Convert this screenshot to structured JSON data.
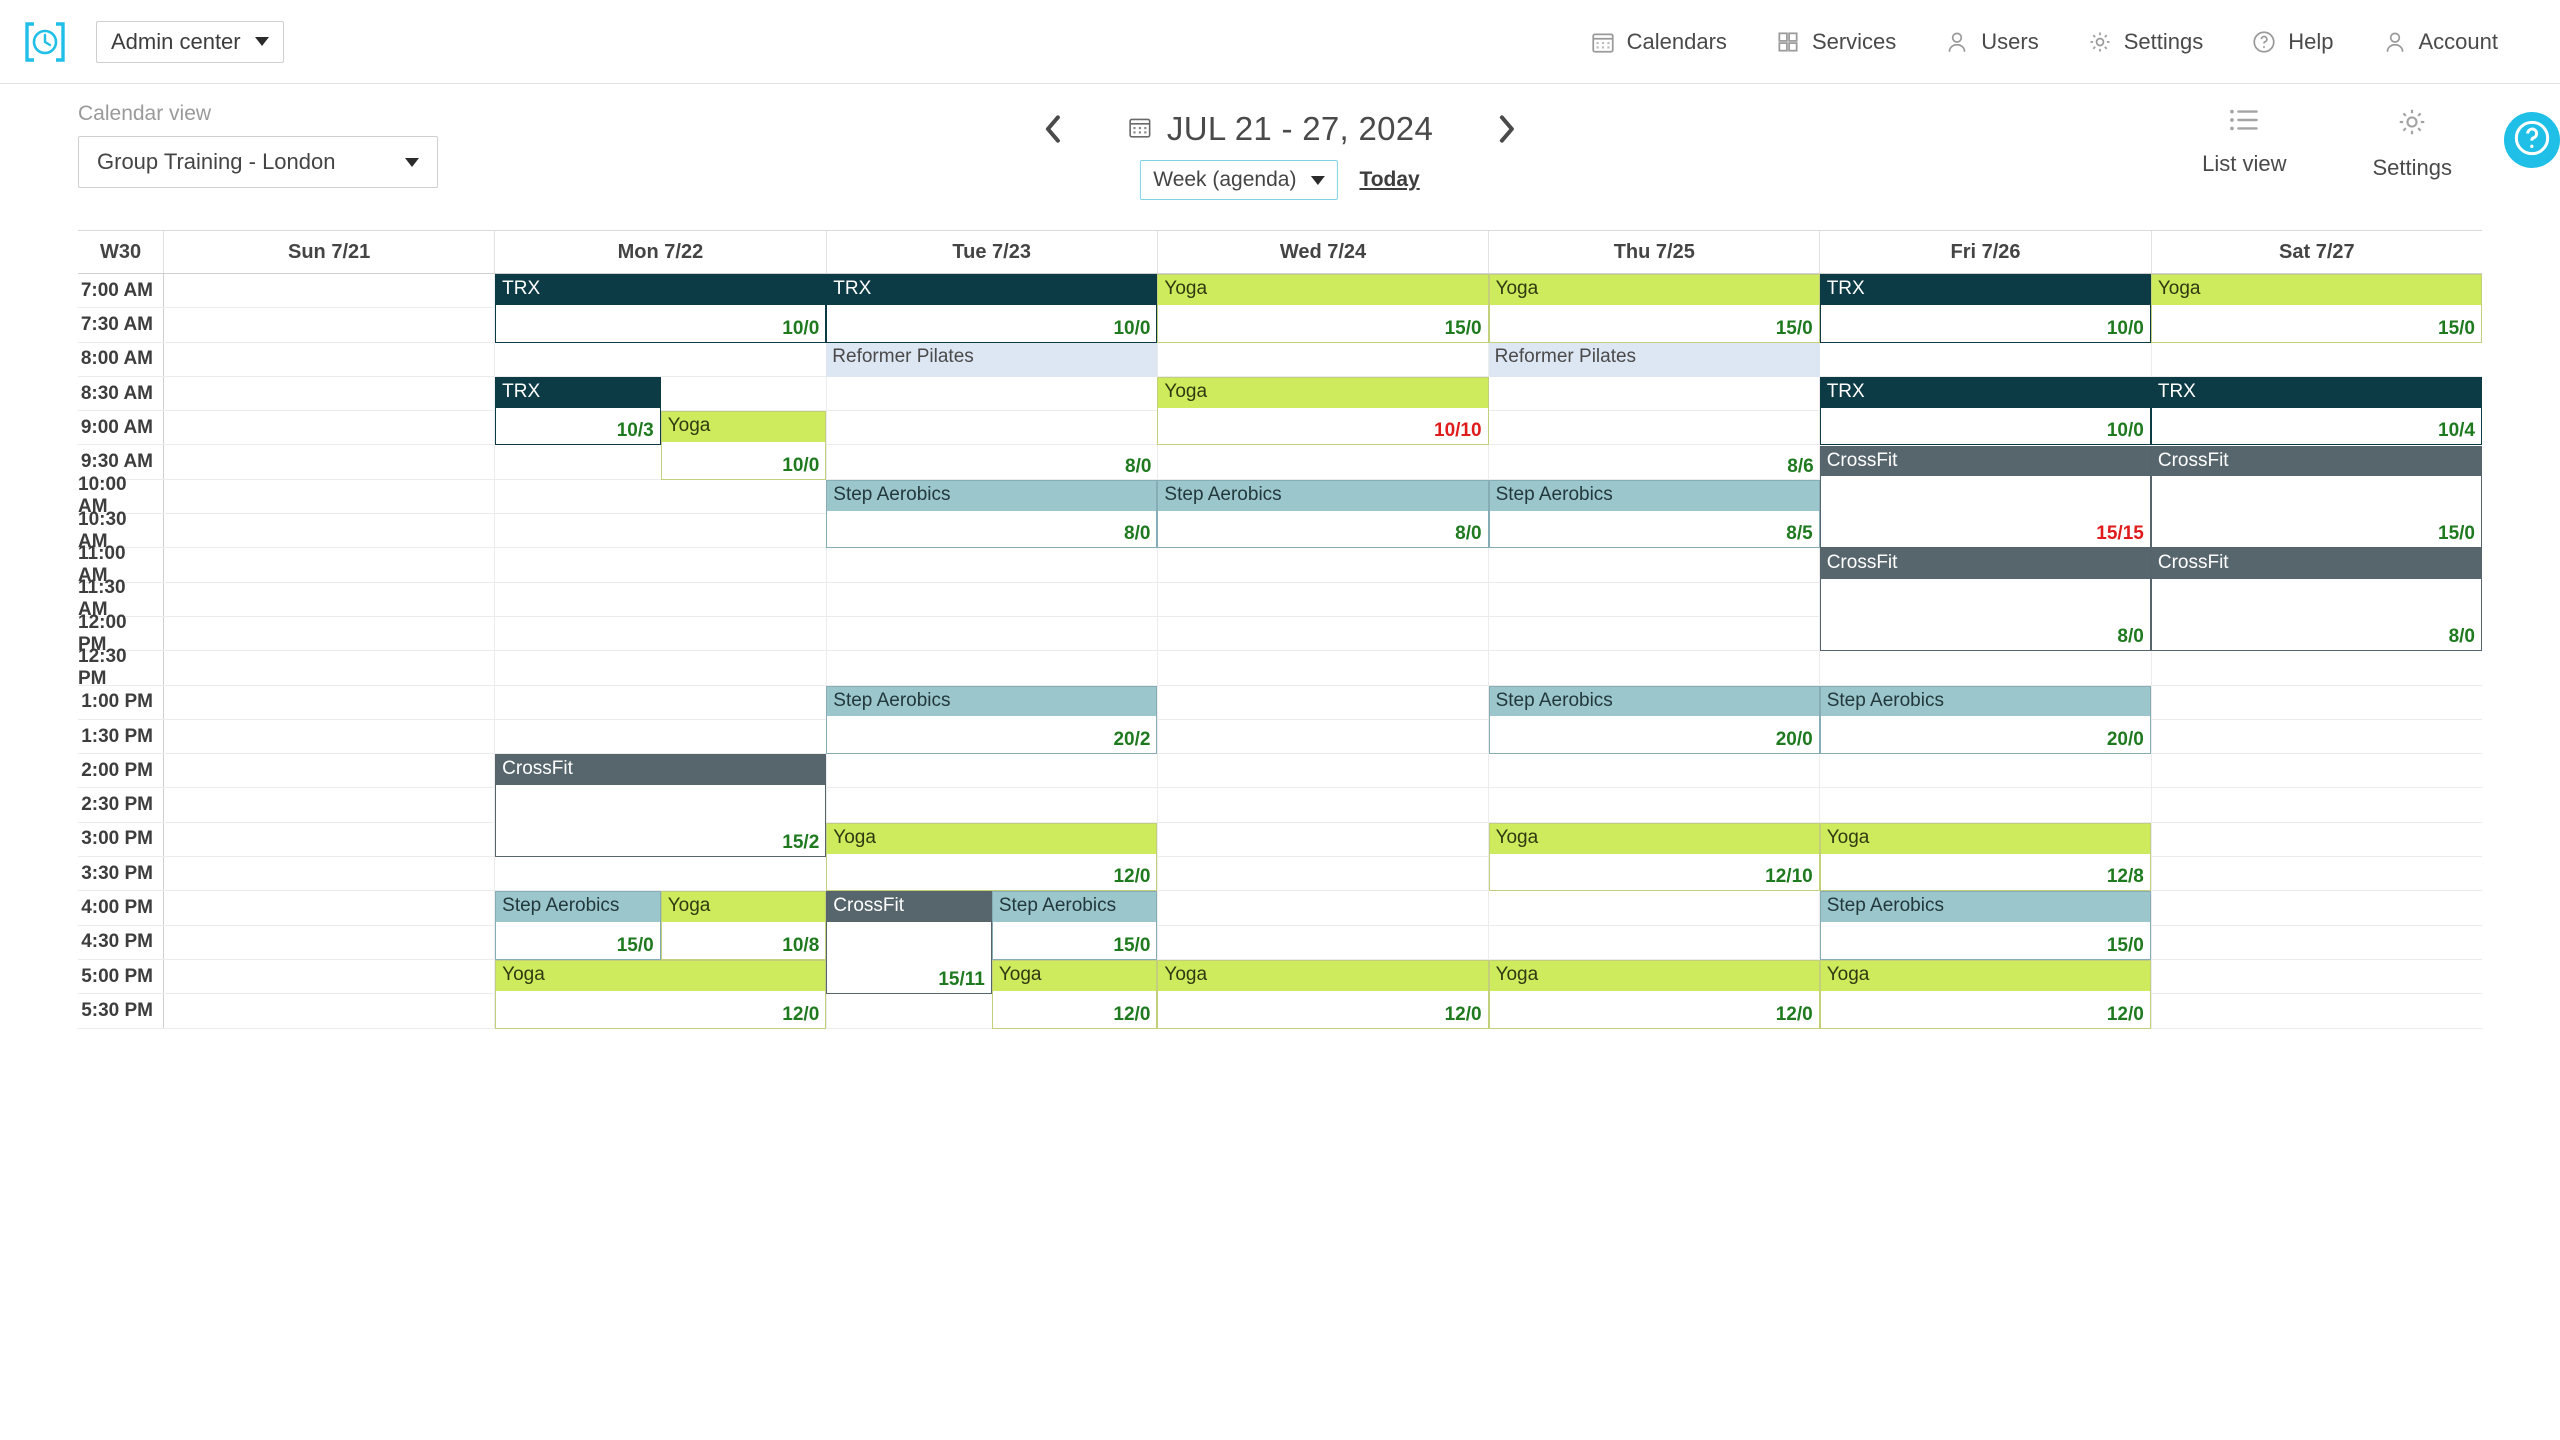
{
  "header": {
    "logo_icon": "clock-bracket-logo",
    "admin_label": "Admin center",
    "nav": [
      {
        "label": "Calendars",
        "icon": "calendar-icon"
      },
      {
        "label": "Services",
        "icon": "grid-icon"
      },
      {
        "label": "Users",
        "icon": "user-icon"
      },
      {
        "label": "Settings",
        "icon": "gear-icon"
      },
      {
        "label": "Help",
        "icon": "question-circle-icon"
      },
      {
        "label": "Account",
        "icon": "user-icon"
      }
    ]
  },
  "toolbar": {
    "calendar_view_label": "Calendar view",
    "calendar_view_value": "Group Training - London",
    "prev_icon": "chevron-left-icon",
    "next_icon": "chevron-right-icon",
    "date_icon": "calendar-icon",
    "date_range": "JUL 21 - 27, 2024",
    "period_value": "Week (agenda)",
    "today_label": "Today",
    "list_view_label": "List view",
    "list_view_icon": "list-icon",
    "settings_label": "Settings",
    "settings_icon": "gear-icon",
    "help_fab_icon": "question-icon"
  },
  "colors": {
    "accent": "#1fbfe8",
    "trx": "#0d3b45",
    "yoga": "#cdeb5c",
    "step_aerobics": "#9bc6cb",
    "crossfit": "#56666c",
    "pilates": "#dde6f3",
    "count_ok": "#1f7a1f",
    "count_full": "#e01b1b"
  },
  "calendar": {
    "week_label": "W30",
    "days": [
      "Sun 7/21",
      "Mon 7/22",
      "Tue 7/23",
      "Wed 7/24",
      "Thu 7/25",
      "Fri 7/26",
      "Sat 7/27"
    ],
    "times": [
      "7:00 AM",
      "7:30 AM",
      "8:00 AM",
      "8:30 AM",
      "9:00 AM",
      "9:30 AM",
      "10:00 AM",
      "10:30 AM",
      "11:00 AM",
      "11:30 AM",
      "12:00 PM",
      "12:30 PM",
      "1:00 PM",
      "1:30 PM",
      "2:00 PM",
      "2:30 PM",
      "3:00 PM",
      "3:30 PM",
      "4:00 PM",
      "4:30 PM",
      "5:00 PM",
      "5:30 PM"
    ],
    "events": [
      {
        "title": "TRX",
        "type": "trx",
        "count": "10/0",
        "full": false,
        "day": 1,
        "start": 0,
        "span": 2,
        "lane": 0,
        "lanes": 1
      },
      {
        "title": "TRX",
        "type": "trx",
        "count": "10/3",
        "full": false,
        "day": 1,
        "start": 3,
        "span": 2,
        "lane": 0,
        "lanes": 2
      },
      {
        "title": "Yoga",
        "type": "yoga",
        "count": "10/0",
        "full": false,
        "day": 1,
        "start": 4,
        "span": 2,
        "lane": 1,
        "lanes": 2
      },
      {
        "title": "CrossFit",
        "type": "cross",
        "count": "15/2",
        "full": false,
        "day": 1,
        "start": 14,
        "span": 3,
        "lane": 0,
        "lanes": 1
      },
      {
        "title": "Step Aerobics",
        "type": "step",
        "count": "15/0",
        "full": false,
        "day": 1,
        "start": 18,
        "span": 2,
        "lane": 0,
        "lanes": 2
      },
      {
        "title": "Yoga",
        "type": "yoga",
        "count": "10/8",
        "full": false,
        "day": 1,
        "start": 18,
        "span": 2,
        "lane": 1,
        "lanes": 2
      },
      {
        "title": "Yoga",
        "type": "yoga",
        "count": "12/0",
        "full": false,
        "day": 1,
        "start": 20,
        "span": 2,
        "lane": 0,
        "lanes": 1
      },
      {
        "title": "TRX",
        "type": "trx",
        "count": "10/0",
        "full": false,
        "day": 2,
        "start": 0,
        "span": 2,
        "lane": 0,
        "lanes": 1
      },
      {
        "title": "Reformer Pilates",
        "type": "pilates",
        "count": "",
        "full": false,
        "day": 2,
        "start": 2,
        "span": 1,
        "lane": 0,
        "lanes": 1
      },
      {
        "title": "",
        "type": "pilates-body",
        "count": "8/0",
        "full": false,
        "day": 2,
        "start": 3,
        "span": 3,
        "lane": 0,
        "lanes": 1,
        "hidden": true
      },
      {
        "title": "Step Aerobics",
        "type": "step",
        "count": "8/0",
        "full": false,
        "day": 2,
        "start": 6,
        "span": 2,
        "lane": 0,
        "lanes": 1
      },
      {
        "title": "Step Aerobics",
        "type": "step",
        "count": "20/2",
        "full": false,
        "day": 2,
        "start": 12,
        "span": 2,
        "lane": 0,
        "lanes": 1
      },
      {
        "title": "Yoga",
        "type": "yoga",
        "count": "12/0",
        "full": false,
        "day": 2,
        "start": 16,
        "span": 2,
        "lane": 0,
        "lanes": 1
      },
      {
        "title": "CrossFit",
        "type": "cross",
        "count": "15/11",
        "full": false,
        "day": 2,
        "start": 18,
        "span": 3,
        "lane": 0,
        "lanes": 2
      },
      {
        "title": "Step Aerobics",
        "type": "step",
        "count": "15/0",
        "full": false,
        "day": 2,
        "start": 18,
        "span": 2,
        "lane": 1,
        "lanes": 2
      },
      {
        "title": "Yoga",
        "type": "yoga",
        "count": "12/0",
        "full": false,
        "day": 2,
        "start": 20,
        "span": 2,
        "lane": 1,
        "lanes": 2
      },
      {
        "title": "Yoga",
        "type": "yoga",
        "count": "15/0",
        "full": false,
        "day": 3,
        "start": 0,
        "span": 2,
        "lane": 0,
        "lanes": 1
      },
      {
        "title": "Yoga",
        "type": "yoga",
        "count": "10/10",
        "full": true,
        "day": 3,
        "start": 3,
        "span": 2,
        "lane": 0,
        "lanes": 1
      },
      {
        "title": "Step Aerobics",
        "type": "step",
        "count": "8/0",
        "full": false,
        "day": 3,
        "start": 6,
        "span": 2,
        "lane": 0,
        "lanes": 1
      },
      {
        "title": "Yoga",
        "type": "yoga",
        "count": "12/0",
        "full": false,
        "day": 3,
        "start": 20,
        "span": 2,
        "lane": 0,
        "lanes": 1
      },
      {
        "title": "Yoga",
        "type": "yoga",
        "count": "15/0",
        "full": false,
        "day": 4,
        "start": 0,
        "span": 2,
        "lane": 0,
        "lanes": 1
      },
      {
        "title": "Reformer Pilates",
        "type": "pilates",
        "count": "",
        "full": false,
        "day": 4,
        "start": 2,
        "span": 1,
        "lane": 0,
        "lanes": 1
      },
      {
        "title": "Step Aerobics",
        "type": "step",
        "count": "8/5",
        "full": false,
        "day": 4,
        "start": 6,
        "span": 2,
        "lane": 0,
        "lanes": 1
      },
      {
        "title": "Step Aerobics",
        "type": "step",
        "count": "20/0",
        "full": false,
        "day": 4,
        "start": 12,
        "span": 2,
        "lane": 0,
        "lanes": 1
      },
      {
        "title": "Yoga",
        "type": "yoga",
        "count": "12/10",
        "full": false,
        "day": 4,
        "start": 16,
        "span": 2,
        "lane": 0,
        "lanes": 1
      },
      {
        "title": "Yoga",
        "type": "yoga",
        "count": "12/0",
        "full": false,
        "day": 4,
        "start": 20,
        "span": 2,
        "lane": 0,
        "lanes": 1
      },
      {
        "title": "TRX",
        "type": "trx",
        "count": "10/0",
        "full": false,
        "day": 5,
        "start": 0,
        "span": 2,
        "lane": 0,
        "lanes": 1
      },
      {
        "title": "TRX",
        "type": "trx",
        "count": "10/0",
        "full": false,
        "day": 5,
        "start": 3,
        "span": 2,
        "lane": 0,
        "lanes": 1
      },
      {
        "title": "CrossFit",
        "type": "cross",
        "count": "15/15",
        "full": true,
        "day": 5,
        "start": 5,
        "span": 3,
        "lane": 0,
        "lanes": 1
      },
      {
        "title": "CrossFit",
        "type": "cross",
        "count": "8/0",
        "full": false,
        "day": 5,
        "start": 8,
        "span": 3,
        "lane": 0,
        "lanes": 1
      },
      {
        "title": "Step Aerobics",
        "type": "step",
        "count": "20/0",
        "full": false,
        "day": 5,
        "start": 12,
        "span": 2,
        "lane": 0,
        "lanes": 1
      },
      {
        "title": "Yoga",
        "type": "yoga",
        "count": "12/8",
        "full": false,
        "day": 5,
        "start": 16,
        "span": 2,
        "lane": 0,
        "lanes": 1
      },
      {
        "title": "Step Aerobics",
        "type": "step",
        "count": "15/0",
        "full": false,
        "day": 5,
        "start": 18,
        "span": 2,
        "lane": 0,
        "lanes": 1
      },
      {
        "title": "Yoga",
        "type": "yoga",
        "count": "12/0",
        "full": false,
        "day": 5,
        "start": 20,
        "span": 2,
        "lane": 0,
        "lanes": 1
      },
      {
        "title": "Yoga",
        "type": "yoga",
        "count": "15/0",
        "full": false,
        "day": 6,
        "start": 0,
        "span": 2,
        "lane": 0,
        "lanes": 1
      },
      {
        "title": "TRX",
        "type": "trx",
        "count": "10/4",
        "full": false,
        "day": 6,
        "start": 3,
        "span": 2,
        "lane": 0,
        "lanes": 1
      },
      {
        "title": "CrossFit",
        "type": "cross",
        "count": "15/0",
        "full": false,
        "day": 6,
        "start": 5,
        "span": 3,
        "lane": 0,
        "lanes": 1
      },
      {
        "title": "CrossFit",
        "type": "cross",
        "count": "8/0",
        "full": false,
        "day": 6,
        "start": 8,
        "span": 3,
        "lane": 0,
        "lanes": 1
      }
    ]
  }
}
